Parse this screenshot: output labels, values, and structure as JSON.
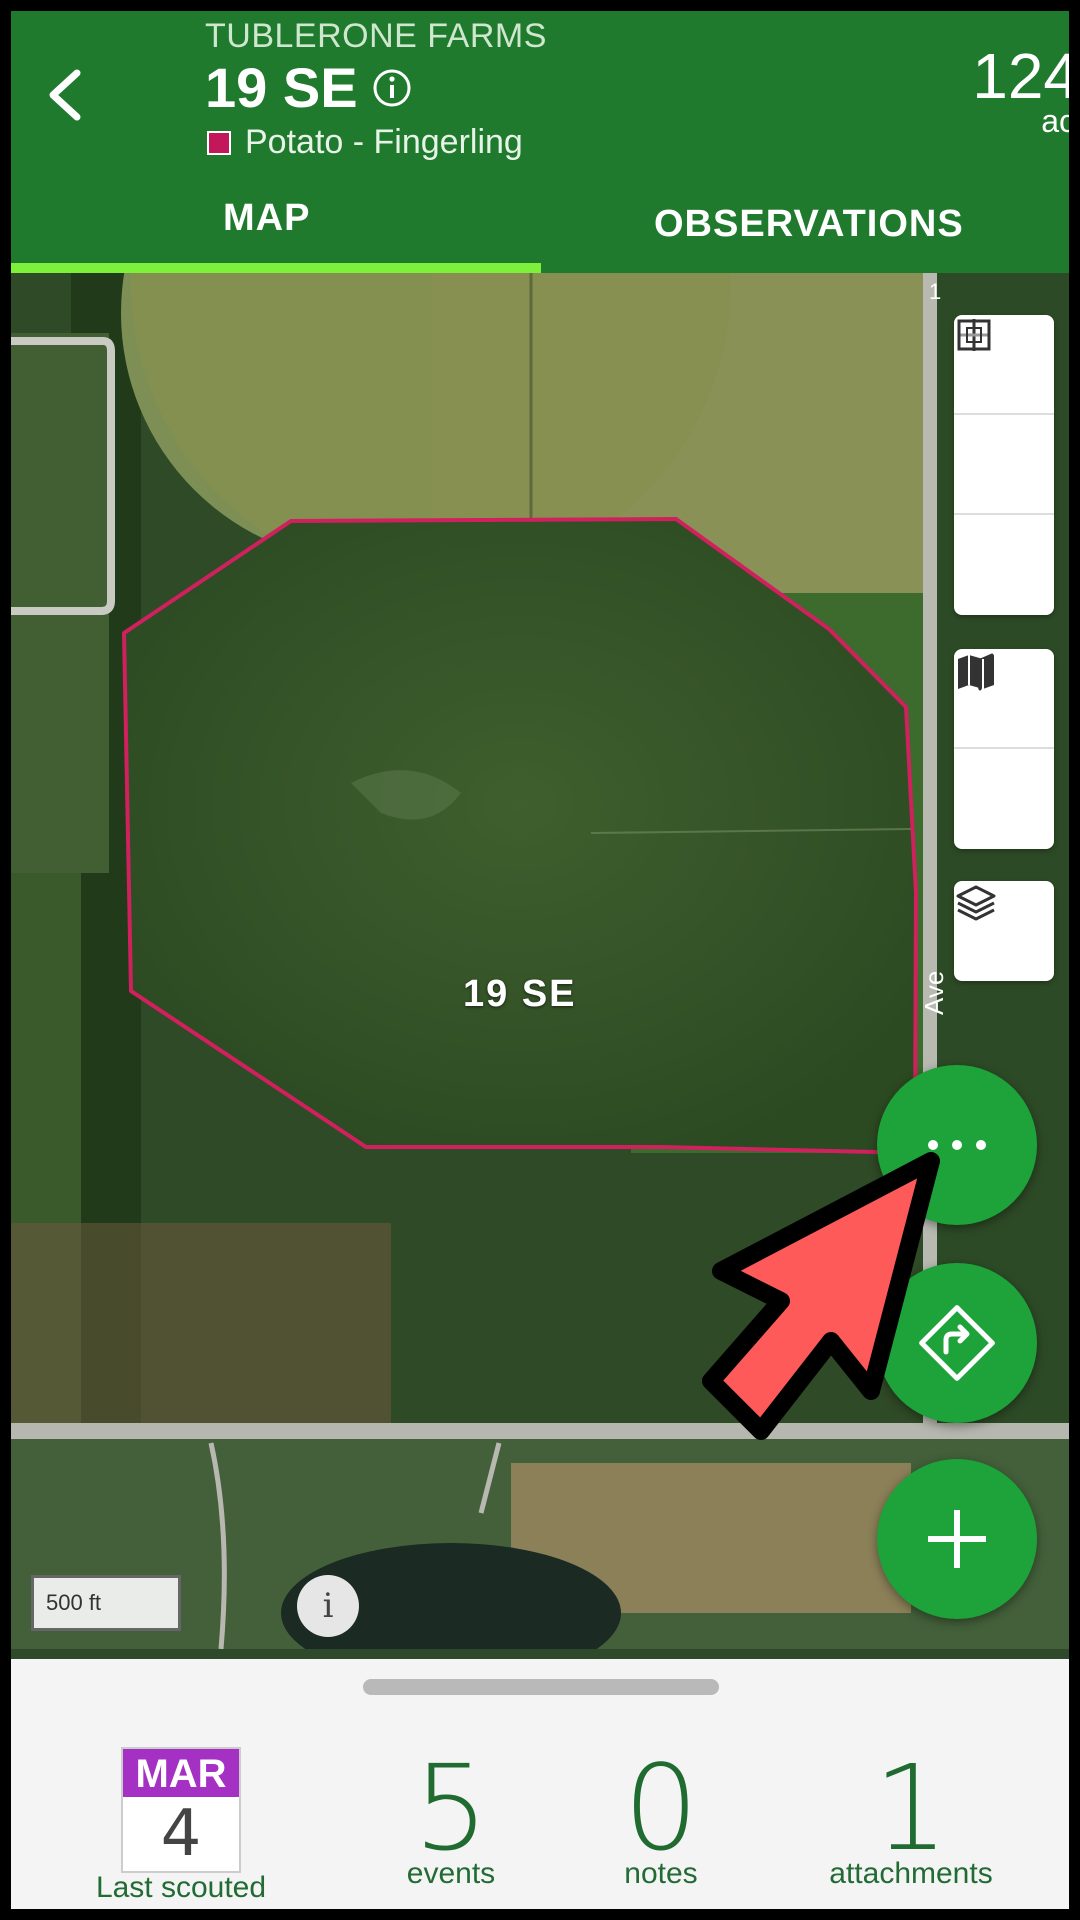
{
  "header": {
    "farm_name": "TUBLERONE FARMS",
    "field_name": "19 SE",
    "crop_name": "Potato - Fingerling",
    "crop_color": "#c2185b",
    "acres_value": "124",
    "acres_unit": "ac"
  },
  "tabs": [
    {
      "label": "MAP",
      "active": true
    },
    {
      "label": "OBSERVATIONS",
      "active": false
    }
  ],
  "map": {
    "field_label": "19 SE",
    "road_label": "Ave",
    "road_label_top": "1",
    "scale_label": "500 ft",
    "info_label": "i",
    "controls": [
      "zoom-in-icon",
      "zoom-out-icon",
      "fit-extent-icon",
      "locate-icon",
      "basemap-icon",
      "layers-icon"
    ],
    "fabs": [
      "more-icon",
      "navigate-icon",
      "add-icon"
    ]
  },
  "summary": {
    "last_scouted_month": "MAR",
    "last_scouted_day": "4",
    "last_scouted_label": "Last scouted",
    "events_count": "5",
    "events_label": "events",
    "notes_count": "0",
    "notes_label": "notes",
    "attachments_count": "1",
    "attachments_label": "attachments"
  },
  "colors": {
    "header_green": "#1f7a2e",
    "tab_indicator": "#7cf03a",
    "fab_green": "#1da33a",
    "field_boundary": "#d0205e",
    "calendar_month": "#a531c4"
  }
}
